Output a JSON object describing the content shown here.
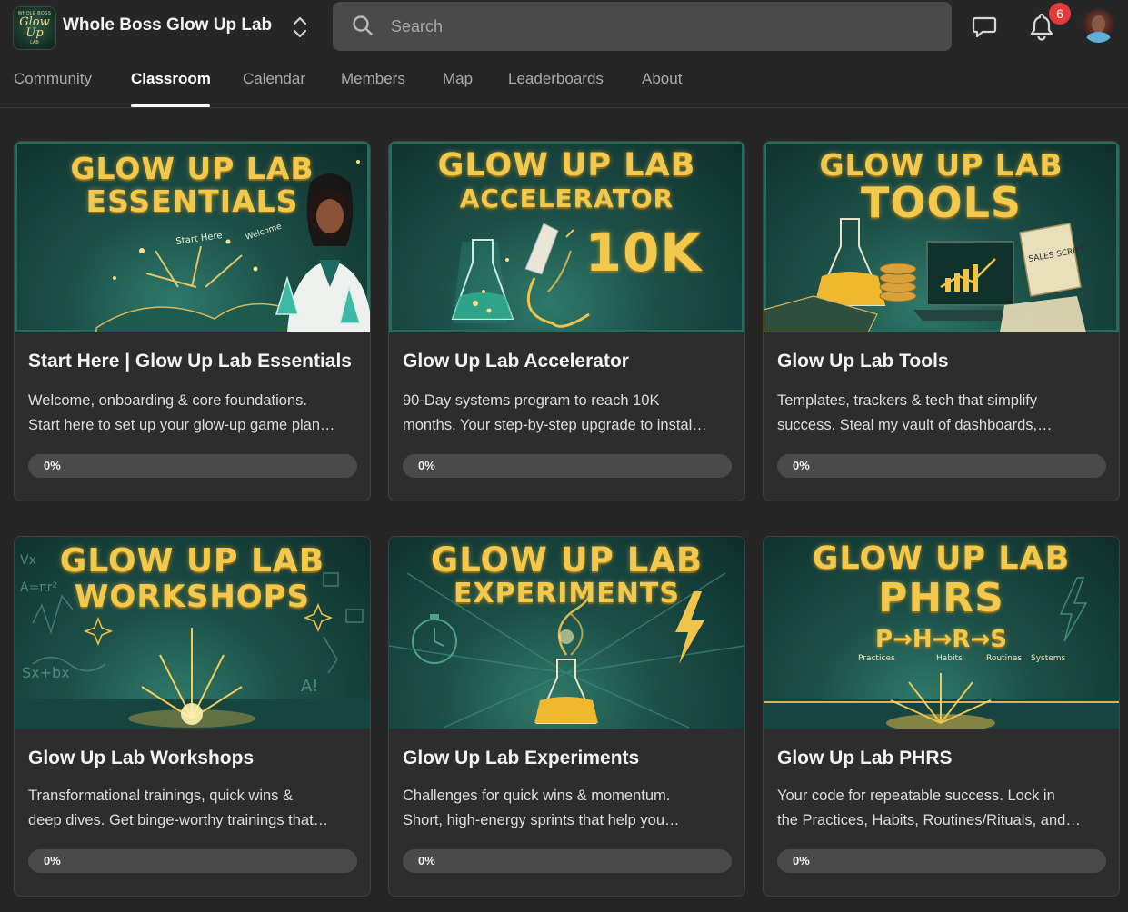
{
  "header": {
    "logo": {
      "line1": "WHOLE BOSS",
      "line2": "Glow Up",
      "line3": "LAB"
    },
    "group_name": "Whole Boss Glow Up Lab",
    "search_placeholder": "Search",
    "notification_count": "6",
    "icons": [
      "switcher-chevrons-icon",
      "search-icon",
      "chat-icon",
      "bell-icon",
      "avatar"
    ]
  },
  "tabs": [
    {
      "label": "Community",
      "active": false
    },
    {
      "label": "Classroom",
      "active": true
    },
    {
      "label": "Calendar",
      "active": false
    },
    {
      "label": "Members",
      "active": false
    },
    {
      "label": "Map",
      "active": false
    },
    {
      "label": "Leaderboards",
      "active": false
    },
    {
      "label": "About",
      "active": false
    }
  ],
  "colors": {
    "background": "#262626",
    "card": "#2d2d2d",
    "accent_gold": "#f2c94c",
    "chalkboard": "#1c4f47",
    "badge": "#e13b3b"
  },
  "courses": [
    {
      "image_line1": "GLOW UP LAB",
      "image_line2": "ESSENTIALS",
      "title": "Start Here | Glow Up Lab Essentials",
      "desc_line1": "Welcome, onboarding & core foundations.",
      "desc_line2": "Start here to set up your glow-up game plan…",
      "progress_label": "0%",
      "progress": 0
    },
    {
      "image_line1": "GLOW UP LAB",
      "image_line2": "ACCELERATOR",
      "image_line3": "10K",
      "title": "Glow Up Lab Accelerator",
      "desc_line1": "90-Day systems program to reach 10K",
      "desc_line2": "months. Your step-by-step upgrade to instal…",
      "progress_label": "0%",
      "progress": 0
    },
    {
      "image_line1": "GLOW UP LAB",
      "image_line2": "TOOLS",
      "title": "Glow Up Lab Tools",
      "desc_line1": "Templates, trackers & tech that simplify",
      "desc_line2": "success. Steal my vault of dashboards,…",
      "progress_label": "0%",
      "progress": 0
    },
    {
      "image_line1": "GLOW UP LAB",
      "image_line2": "WORKSHOPS",
      "title": "Glow Up Lab Workshops",
      "desc_line1": "Transformational trainings, quick wins &",
      "desc_line2": "deep dives. Get binge-worthy trainings that…",
      "progress_label": "0%",
      "progress": 0
    },
    {
      "image_line1": "GLOW UP LAB",
      "image_line2": "EXPERIMENTS",
      "title": "Glow Up Lab Experiments",
      "desc_line1": "Challenges for quick wins & momentum.",
      "desc_line2": "Short, high-energy sprints that help you…",
      "progress_label": "0%",
      "progress": 0
    },
    {
      "image_line1": "GLOW UP LAB",
      "image_line2": "PHRS",
      "image_line3": "P→H→R→S",
      "title": "Glow Up Lab PHRS",
      "desc_line1": "Your code for repeatable success. Lock in",
      "desc_line2": "the Practices, Habits, Routines/Rituals, and…",
      "progress_label": "0%",
      "progress": 0
    }
  ]
}
